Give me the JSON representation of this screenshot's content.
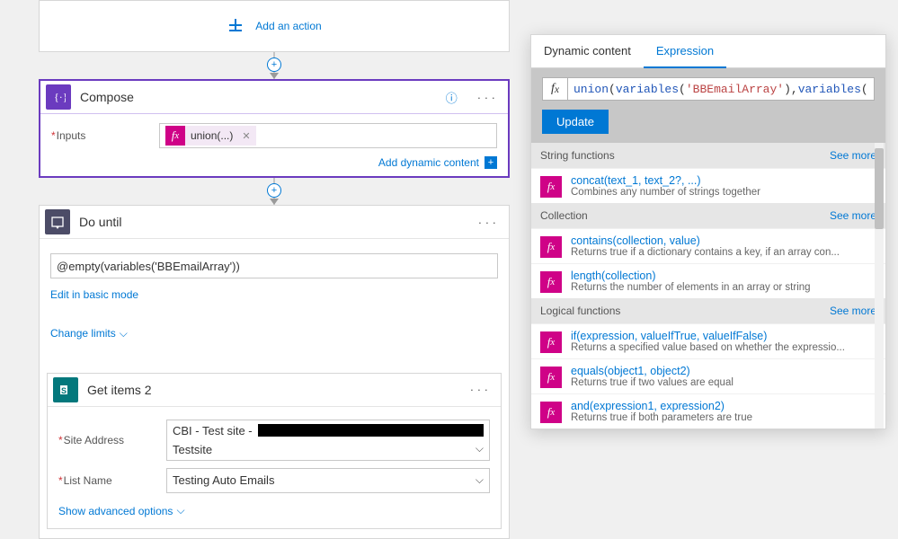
{
  "flow": {
    "add_action_label": "Add an action",
    "compose": {
      "title": "Compose",
      "inputs_label": "Inputs",
      "token_label": "union(...)",
      "add_dynamic_label": "Add dynamic content"
    },
    "do_until": {
      "title": "Do until",
      "expression": "@empty(variables('BBEmailArray'))",
      "edit_basic": "Edit in basic mode",
      "change_limits": "Change limits"
    },
    "get_items": {
      "title": "Get items 2",
      "site_label": "Site Address",
      "site_prefix": "CBI - Test site -",
      "site_line2": "Testsite",
      "list_label": "List Name",
      "list_value": "Testing Auto Emails",
      "show_advanced": "Show advanced options"
    }
  },
  "panel": {
    "tab_dynamic": "Dynamic content",
    "tab_expression": "Expression",
    "expr_parts": {
      "fn": "union",
      "p1": "(",
      "var1": "variables",
      "p2": "(",
      "str1": "'BBEmailArray'",
      "p3": "),",
      "var2": "variables",
      "p4": "("
    },
    "update_label": "Update",
    "see_more": "See more",
    "sections": {
      "string": "String functions",
      "collection": "Collection",
      "logical": "Logical functions"
    },
    "fns": {
      "concat_sig": "concat(text_1, text_2?, ...)",
      "concat_desc": "Combines any number of strings together",
      "contains_sig": "contains(collection, value)",
      "contains_desc": "Returns true if a dictionary contains a key, if an array con...",
      "length_sig": "length(collection)",
      "length_desc": "Returns the number of elements in an array or string",
      "if_sig": "if(expression, valueIfTrue, valueIfFalse)",
      "if_desc": "Returns a specified value based on whether the expressio...",
      "equals_sig": "equals(object1, object2)",
      "equals_desc": "Returns true if two values are equal",
      "and_sig": "and(expression1, expression2)",
      "and_desc": "Returns true if both parameters are true"
    }
  }
}
